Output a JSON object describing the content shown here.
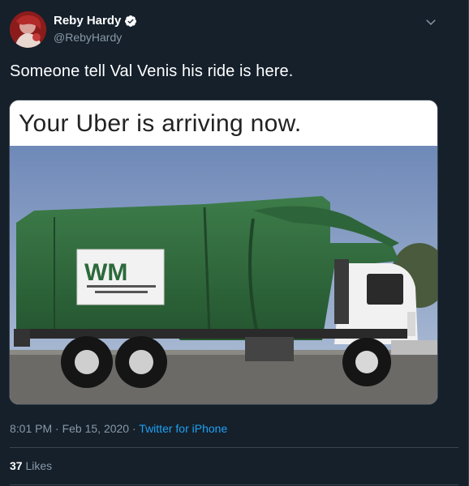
{
  "author": {
    "display_name": "Reby Hardy",
    "handle": "@RebyHardy",
    "verified": true
  },
  "tweet": {
    "text": "Someone tell Val Venis his ride is here.",
    "image_caption": "Your Uber is arriving now.",
    "truck_logo": "WM",
    "timestamp": "8:01 PM · Feb 15, 2020",
    "separator": " · ",
    "source": "Twitter for iPhone"
  },
  "stats": {
    "likes_count": "37",
    "likes_label": "Likes"
  },
  "icons": {
    "verified": "verified-badge-icon",
    "menu": "chevron-down-icon"
  },
  "colors": {
    "background": "#15202b",
    "secondary_text": "#8899a6",
    "accent": "#1da1f2",
    "truck_green": "#2f6b3c"
  }
}
